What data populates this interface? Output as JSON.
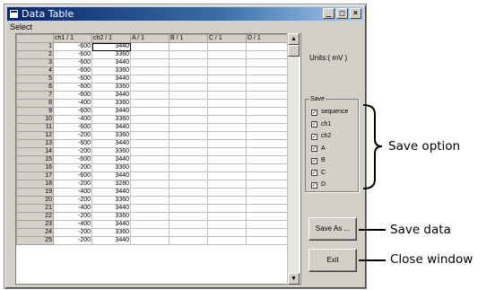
{
  "window": {
    "title": "Data Table",
    "menu": [
      "Select"
    ],
    "controls": [
      "minimize-icon",
      "maximize-icon",
      "close-icon"
    ]
  },
  "table": {
    "columns": [
      "",
      "ch1 / 1",
      "ch2 / 1",
      "A / 1",
      "B / 1",
      "C / 1",
      "D / 1"
    ],
    "rows": [
      [
        "1",
        "-600",
        "3440"
      ],
      [
        "2",
        "-600",
        "3360"
      ],
      [
        "3",
        "-600",
        "3440"
      ],
      [
        "4",
        "-600",
        "3360"
      ],
      [
        "5",
        "-600",
        "3440"
      ],
      [
        "6",
        "-600",
        "3360"
      ],
      [
        "7",
        "-600",
        "3440"
      ],
      [
        "8",
        "-400",
        "3360"
      ],
      [
        "9",
        "-600",
        "3440"
      ],
      [
        "10",
        "-400",
        "3360"
      ],
      [
        "11",
        "-600",
        "3440"
      ],
      [
        "12",
        "-200",
        "3360"
      ],
      [
        "13",
        "-600",
        "3440"
      ],
      [
        "14",
        "-200",
        "3360"
      ],
      [
        "15",
        "-600",
        "3440"
      ],
      [
        "16",
        "-200",
        "3360"
      ],
      [
        "17",
        "-600",
        "3440"
      ],
      [
        "18",
        "-200",
        "3280"
      ],
      [
        "19",
        "-400",
        "3440"
      ],
      [
        "20",
        "-200",
        "3360"
      ],
      [
        "21",
        "-400",
        "3440"
      ],
      [
        "22",
        "-200",
        "3360"
      ],
      [
        "23",
        "-400",
        "3440"
      ],
      [
        "24",
        "-200",
        "3360"
      ],
      [
        "25",
        "-200",
        "3440"
      ]
    ]
  },
  "scrollbar": {
    "up_icon": "arrow-up-icon",
    "down_icon": "arrow-down-icon"
  },
  "units_label": "Units:( mV )",
  "save_group": {
    "legend": "Save",
    "options": [
      {
        "label": "sequence",
        "checked": true
      },
      {
        "label": "ch1",
        "checked": true
      },
      {
        "label": "ch2",
        "checked": true
      },
      {
        "label": "A",
        "checked": true
      },
      {
        "label": "B",
        "checked": true
      },
      {
        "label": "C",
        "checked": true
      },
      {
        "label": "D",
        "checked": true
      }
    ]
  },
  "buttons": {
    "save_as": "Save As ...",
    "exit": "Exit"
  },
  "annotations": {
    "save_option": "Save option",
    "save_data": "Save data",
    "close_window": "Close window"
  }
}
